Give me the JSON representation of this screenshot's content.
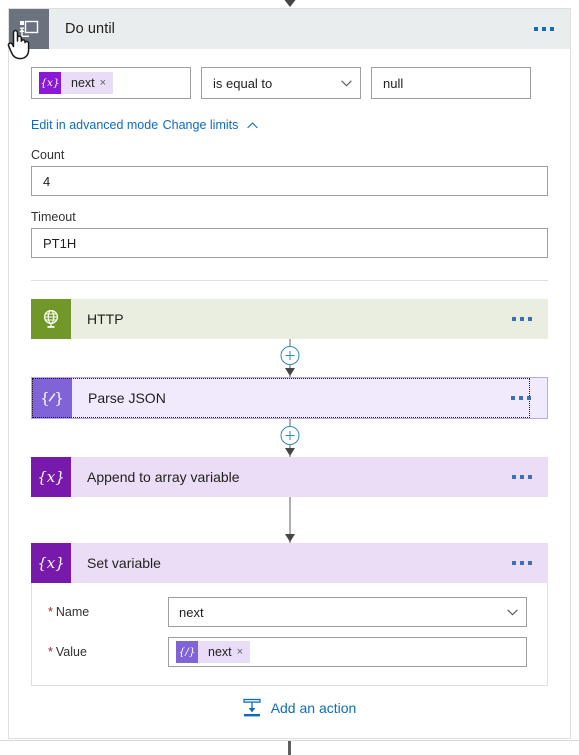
{
  "colors": {
    "scope_header_bg": "#eaeded",
    "scope_icon_bg": "#69727d",
    "link_blue": "#0f6cbd",
    "token_purple": "#8b18d6",
    "token_bg": "#e9dcf7",
    "http_green": "#709727",
    "http_card_bg": "#eaeee0",
    "parse_json_purple": "#8163d8",
    "parse_json_card_bg": "#f1e9fc",
    "variable_purple": "#7719aa",
    "variable_card_bg": "#ecddf7",
    "required_red": "#a4262c",
    "connector_blue": "#2a8ac7"
  },
  "scope": {
    "title": "Do until",
    "icon": "do-until-loop-icon",
    "menu": "ellipsis-icon",
    "condition": {
      "left_token": {
        "icon": "variable-token-icon",
        "icon_glyph": "{x}",
        "label": "next",
        "remove": "×"
      },
      "operator": {
        "selected": "is equal to",
        "chevron": "chevron-down-icon"
      },
      "right_value": "null"
    },
    "advanced_link": "Edit in advanced mode",
    "change_limits_link": "Change limits",
    "change_limits_chevron": "chevron-up-icon",
    "limits": [
      {
        "label": "Count",
        "value": "4"
      },
      {
        "label": "Timeout",
        "value": "PT1H"
      }
    ]
  },
  "actions": [
    {
      "name": "HTTP",
      "icon": "globe-http-icon",
      "icon_glyph": "",
      "menu": "ellipsis-icon",
      "selected": false
    },
    {
      "name": "Parse JSON",
      "icon": "parse-json-icon",
      "icon_glyph": "{/}",
      "menu": "ellipsis-icon",
      "selected": true
    },
    {
      "name": "Append to array variable",
      "icon": "variable-icon",
      "icon_glyph": "{x}",
      "menu": "ellipsis-icon",
      "selected": false
    },
    {
      "name": "Set variable",
      "icon": "variable-icon",
      "icon_glyph": "{x}",
      "menu": "ellipsis-icon",
      "selected": false
    }
  ],
  "set_variable": {
    "name_field": {
      "required_mark": "*",
      "label": "Name",
      "value": "next",
      "chevron": "chevron-down-icon"
    },
    "value_field": {
      "required_mark": "*",
      "label": "Value",
      "token": {
        "icon": "parse-json-token-icon",
        "icon_glyph": "{/}",
        "label": "next",
        "remove": "×"
      }
    }
  },
  "add_action": {
    "label": "Add an action",
    "icon": "insert-action-icon"
  },
  "connectors": {
    "insert_icon": "plus-circle-icon",
    "arrow_icon": "arrow-down-icon"
  }
}
